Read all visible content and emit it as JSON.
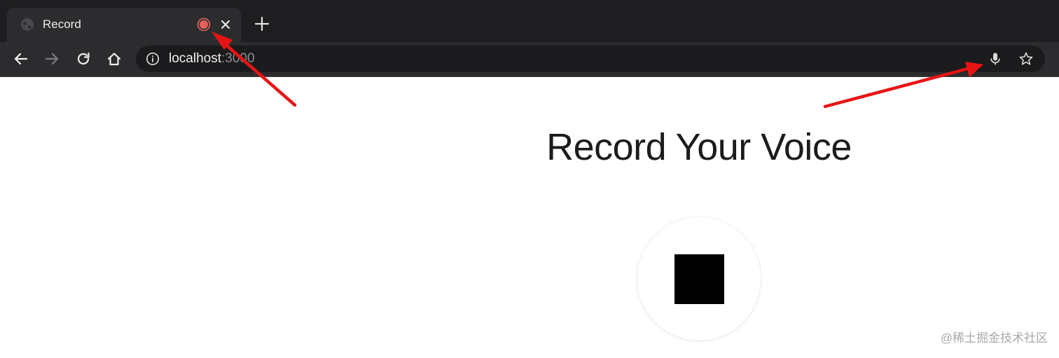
{
  "browser": {
    "tab": {
      "title": "Record",
      "favicon": "globe-icon",
      "indicator": "recording-indicator-icon",
      "close_icon": "close-icon"
    },
    "new_tab_icon": "plus-icon",
    "nav": [
      "back-arrow-icon",
      "forward-arrow-icon",
      "reload-icon",
      "home-icon"
    ],
    "omnibox": {
      "security_icon": "info-icon",
      "url_host": "localhost",
      "url_port": ":3000",
      "mic_icon": "microphone-icon",
      "bookmark_icon": "star-icon"
    }
  },
  "page": {
    "title": "Record Your Voice",
    "stop_button_icon": "stop-square-icon"
  },
  "annotations": {
    "color": "#e81414",
    "arrows": [
      "arrow-to-recording-indicator",
      "arrow-to-microphone-icon"
    ]
  },
  "watermark": "@稀土掘金技术社区",
  "colors": {
    "tabstrip_bg": "#1e1e20",
    "toolbar_bg": "#2c2c2f",
    "recording_red": "#e8625e",
    "arrow_red": "#e81414"
  }
}
